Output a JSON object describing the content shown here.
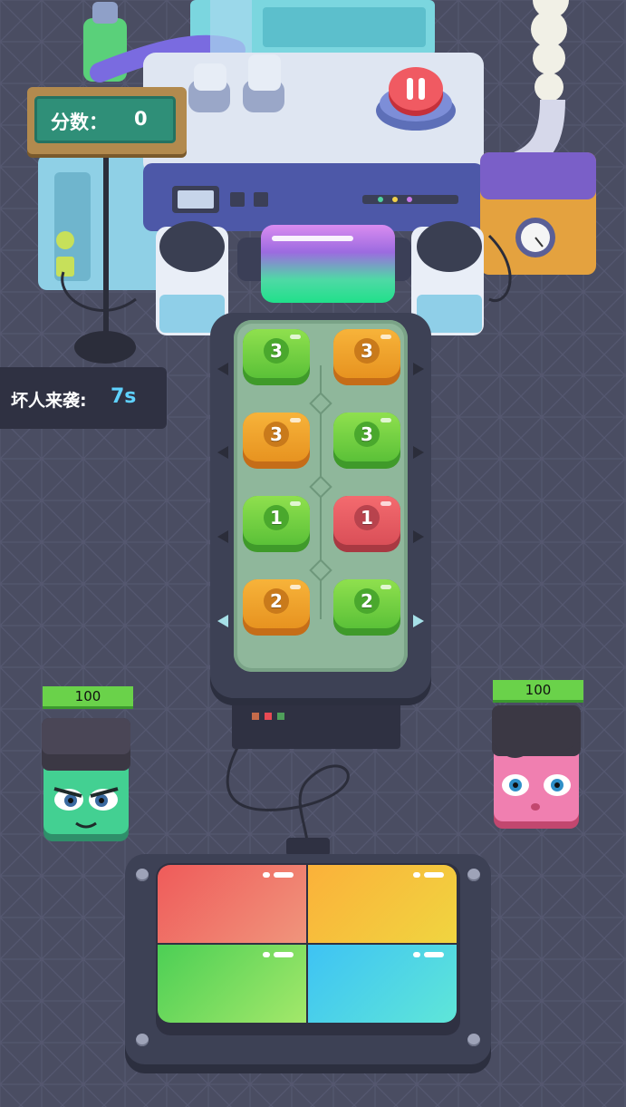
{
  "score": {
    "label": "分数：",
    "value": "0"
  },
  "enemy_timer": {
    "label": "坏人来袭:",
    "seconds": "7s"
  },
  "board": {
    "tiles": [
      {
        "number": "3",
        "color": "green"
      },
      {
        "number": "3",
        "color": "orange"
      },
      {
        "number": "3",
        "color": "orange"
      },
      {
        "number": "3",
        "color": "green"
      },
      {
        "number": "1",
        "color": "green"
      },
      {
        "number": "1",
        "color": "red"
      },
      {
        "number": "2",
        "color": "orange"
      },
      {
        "number": "2",
        "color": "green"
      }
    ]
  },
  "player_left": {
    "health": "100"
  },
  "player_right": {
    "health": "100"
  },
  "pad": {
    "quadrants": [
      "red",
      "orange",
      "green",
      "blue"
    ]
  },
  "colors": {
    "background": "#4a4d62",
    "score_panel": "#2f8f78",
    "timer_accent": "#5fd2ff",
    "health": "#6ad24a",
    "pause_button": "#e84a54"
  },
  "icons": [
    "pause-icon",
    "gauge-icon",
    "lamp-post-icon"
  ]
}
